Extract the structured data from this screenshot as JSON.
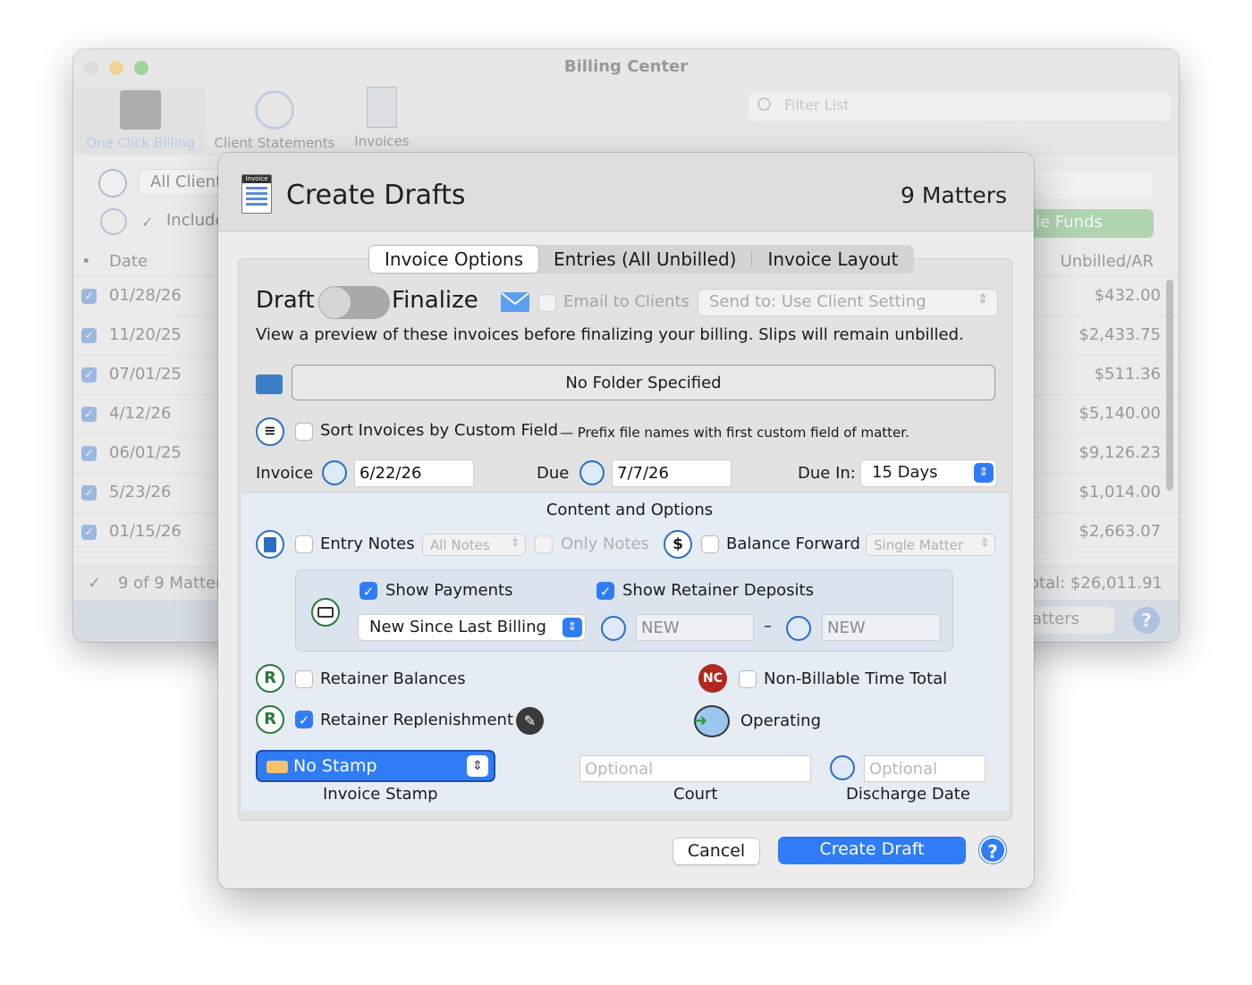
{
  "background_window": {
    "title": "Billing Center",
    "toolbar": [
      {
        "label": "One Click Billing",
        "icon": "cabinet-icon"
      },
      {
        "label": "Client Statements",
        "icon": "person-icon"
      },
      {
        "label": "Invoices",
        "icon": "invoice-icon"
      }
    ],
    "filter_placeholder": "Filter List",
    "client_popup": "All Client",
    "include_label": "Include",
    "funds_button": "le Funds",
    "columns": {
      "dot": "•",
      "date": "Date",
      "unbilled": "Unbilled/AR"
    },
    "rows": [
      {
        "date": "01/28/26",
        "amount": "$432.00"
      },
      {
        "date": "11/20/25",
        "amount": "$2,433.75"
      },
      {
        "date": "07/01/25",
        "amount": "$511.36"
      },
      {
        "date": "4/12/26",
        "amount": "$5,140.00"
      },
      {
        "date": "06/01/25",
        "amount": "$9,126.23"
      },
      {
        "date": "5/23/26",
        "amount": "$1,014.00"
      },
      {
        "date": "01/15/26",
        "amount": "$2,663.07"
      }
    ],
    "footer_count": "9 of 9 Matter",
    "footer_total": "Total: $26,011.91",
    "matters_button": "atters"
  },
  "sheet": {
    "title": "Create Drafts",
    "matter_count": "9 Matters",
    "tabs": [
      "Invoice Options",
      "Entries (All Unbilled)",
      "Invoice Layout"
    ],
    "draft_label": "Draft",
    "finalize_label": "Finalize",
    "email_label": "Email to Clients",
    "send_to": "Send to: Use Client Setting",
    "description": "View a preview of these invoices before finalizing your billing. Slips will remain unbilled.",
    "folder_button": "No Folder Specified",
    "sort_label": "Sort Invoices by Custom Field",
    "sort_hint": "— Prefix file names with first custom field of matter.",
    "invoice_label": "Invoice",
    "invoice_date": "6/22/26",
    "due_label": "Due",
    "due_date": "7/7/26",
    "due_in_label": "Due In:",
    "due_in_value": "15 Days",
    "content_header": "Content and Options",
    "entry_notes_label": "Entry Notes",
    "entry_notes_popup": "All Notes",
    "only_notes_label": "Only Notes",
    "balance_forward_label": "Balance Forward",
    "balance_forward_popup": "Single Matter",
    "show_payments_label": "Show Payments",
    "show_retainer_label": "Show Retainer Deposits",
    "payments_range": "New Since Last Billing",
    "range_start": "NEW",
    "range_end": "NEW",
    "range_dash": "–",
    "retainer_balances_label": "Retainer Balances",
    "non_billable_label": "Non-Billable Time Total",
    "nc_badge": "NC",
    "r_badge": "R",
    "retainer_replenishment_label": "Retainer Replenishment",
    "operating_label": "Operating",
    "stamp_value": "No Stamp",
    "stamp_caption": "Invoice Stamp",
    "court_placeholder": "Optional",
    "court_caption": "Court",
    "discharge_placeholder": "Optional",
    "discharge_caption": "Discharge Date",
    "cancel_button": "Cancel",
    "create_button": "Create Draft",
    "invoice_icon_text": "Invoice"
  },
  "colors": {
    "accent": "#2f7cf6",
    "green": "#2a7a3b",
    "nc": "#b0281e"
  }
}
